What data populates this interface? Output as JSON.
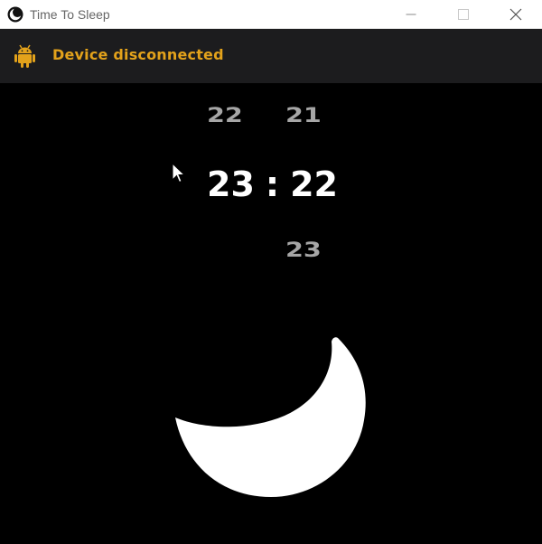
{
  "window": {
    "title": "Time To Sleep",
    "icon": "crescent-moon-app-icon",
    "controls": [
      "minimize-icon",
      "maximize-icon",
      "close-icon"
    ]
  },
  "status": {
    "icon": "android-icon",
    "text": "Device disconnected",
    "color": "#e3a21b"
  },
  "time_picker": {
    "hour_previous": "22",
    "minute_previous": "21",
    "hour": "23",
    "separator": ":",
    "minute": "22",
    "minute_next": "23"
  },
  "illustration": {
    "icon": "crescent-moon-icon",
    "color": "#ffffff"
  },
  "colors": {
    "background": "#000000",
    "statusbar": "#1c1c1e",
    "accent": "#e3a21b",
    "dim_text": "#a6a6a6"
  }
}
